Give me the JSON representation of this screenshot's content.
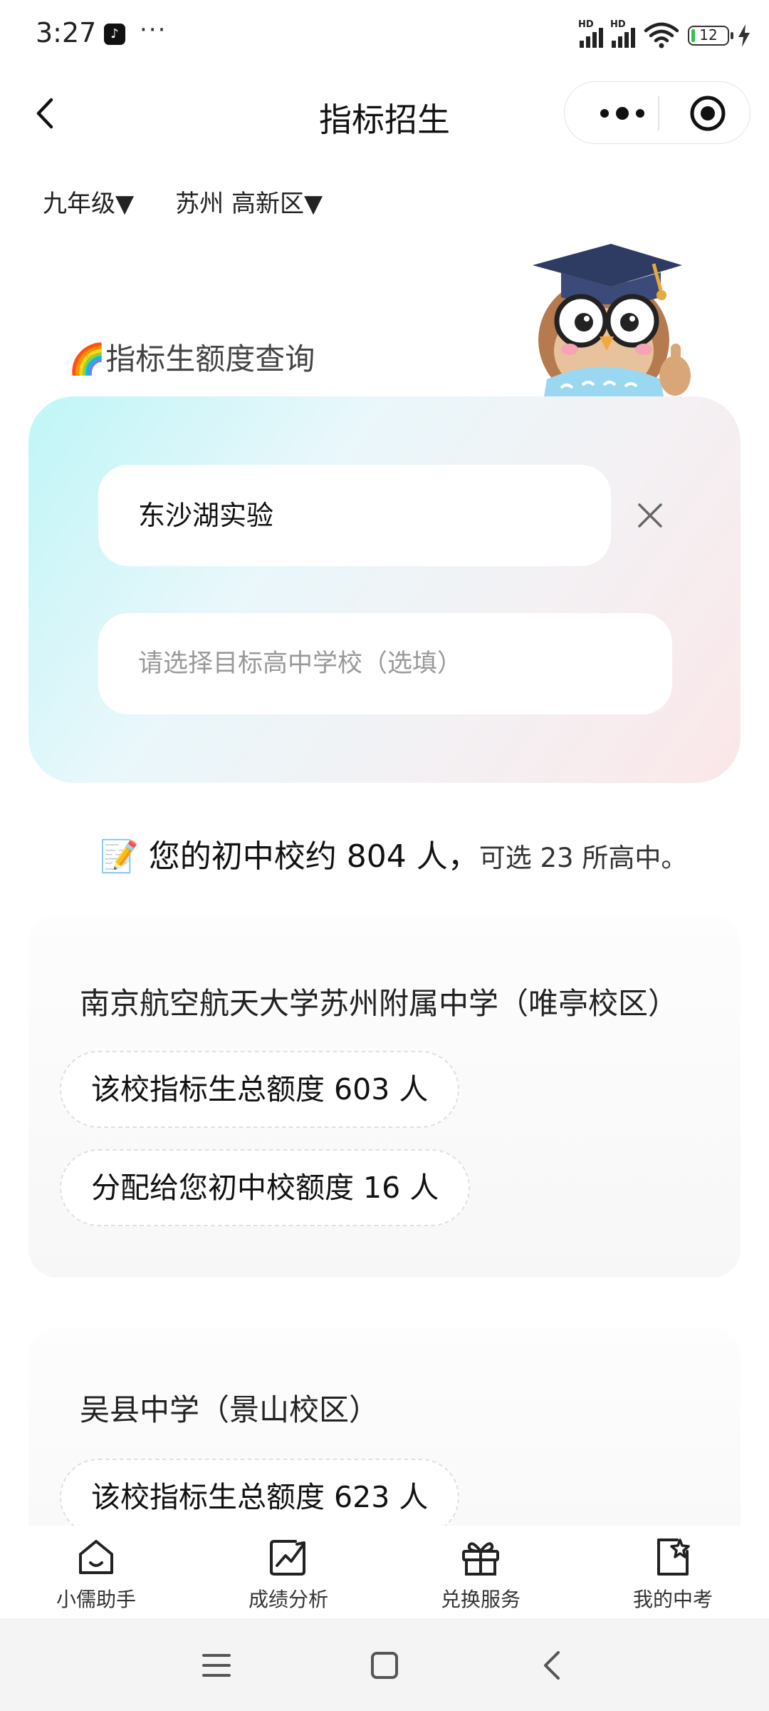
{
  "status_bar": {
    "time": "3:27",
    "app_icon": "tiktok-icon",
    "more": "···",
    "signal_label": "HD",
    "battery": "12"
  },
  "nav": {
    "title": "指标招生",
    "back_icon": "chevron-left-icon",
    "more_icon": "more-dots-icon",
    "target_icon": "target-icon"
  },
  "filters": {
    "grade": "九年级▼",
    "region": "苏州 高新区▼"
  },
  "query": {
    "section_title": "🌈指标生额度查询",
    "school_input_value": "东沙湖实验",
    "target_placeholder": "请选择目标高中学校（选填）"
  },
  "summary": {
    "main": "📝 您的初中校约 804 人，",
    "rest": "可选 23 所高中。"
  },
  "results": [
    {
      "school": "南京航空航天大学苏州附属中学（唯亭校区）",
      "total_quota": "该校指标生总额度 603 人",
      "your_quota": "分配给您初中校额度 16 人"
    },
    {
      "school": "吴县中学（景山校区）",
      "total_quota": "该校指标生总额度 623 人"
    }
  ],
  "tabbar": [
    {
      "label": "小儒助手",
      "icon": "home-smile-icon"
    },
    {
      "label": "成绩分析",
      "icon": "chart-trend-icon"
    },
    {
      "label": "兑换服务",
      "icon": "gift-icon"
    },
    {
      "label": "我的中考",
      "icon": "star-doc-icon"
    }
  ],
  "colors": {
    "card_gradient_start": "#bff6f7",
    "card_gradient_end": "#fbe7e8",
    "battery_fill": "#33c24d"
  }
}
